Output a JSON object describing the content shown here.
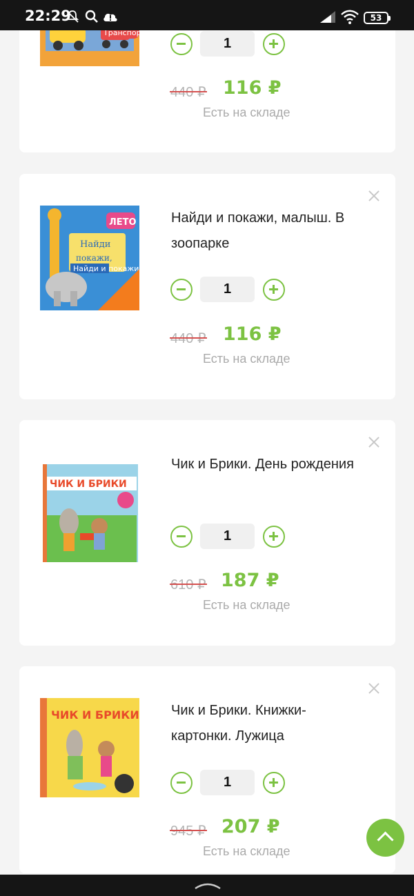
{
  "status_bar": {
    "time": "22:29",
    "battery": "53",
    "icons": [
      "bell-off-icon",
      "search-icon",
      "cloud-alert-icon",
      "signal-icon",
      "wifi-icon",
      "battery-icon"
    ]
  },
  "colors": {
    "accent": "#7cc242",
    "strike": "#d5504f",
    "muted": "#aaaaaa"
  },
  "cart": {
    "items": [
      {
        "title": "",
        "quantity": "1",
        "old_price": "440 ₽",
        "price": "116 ₽",
        "stock": "Есть на складе",
        "cover_text": "Транспорт"
      },
      {
        "title": "Найди и покажи, малыш. В зоопарке",
        "quantity": "1",
        "old_price": "440 ₽",
        "price": "116 ₽",
        "stock": "Есть на складе",
        "cover_text": "Найди и покажи, малыш"
      },
      {
        "title": "Чик и Брики. День рождения",
        "quantity": "1",
        "old_price": "610 ₽",
        "price": "187 ₽",
        "stock": "Есть на складе",
        "cover_text": "ЧИК И БРИКИ"
      },
      {
        "title": "Чик и Брики. Книжки-картонки. Лужица",
        "quantity": "1",
        "old_price": "945 ₽",
        "price": "207 ₽",
        "stock": "Есть на складе",
        "cover_text": "ЧИК И БРИКИ"
      }
    ]
  }
}
